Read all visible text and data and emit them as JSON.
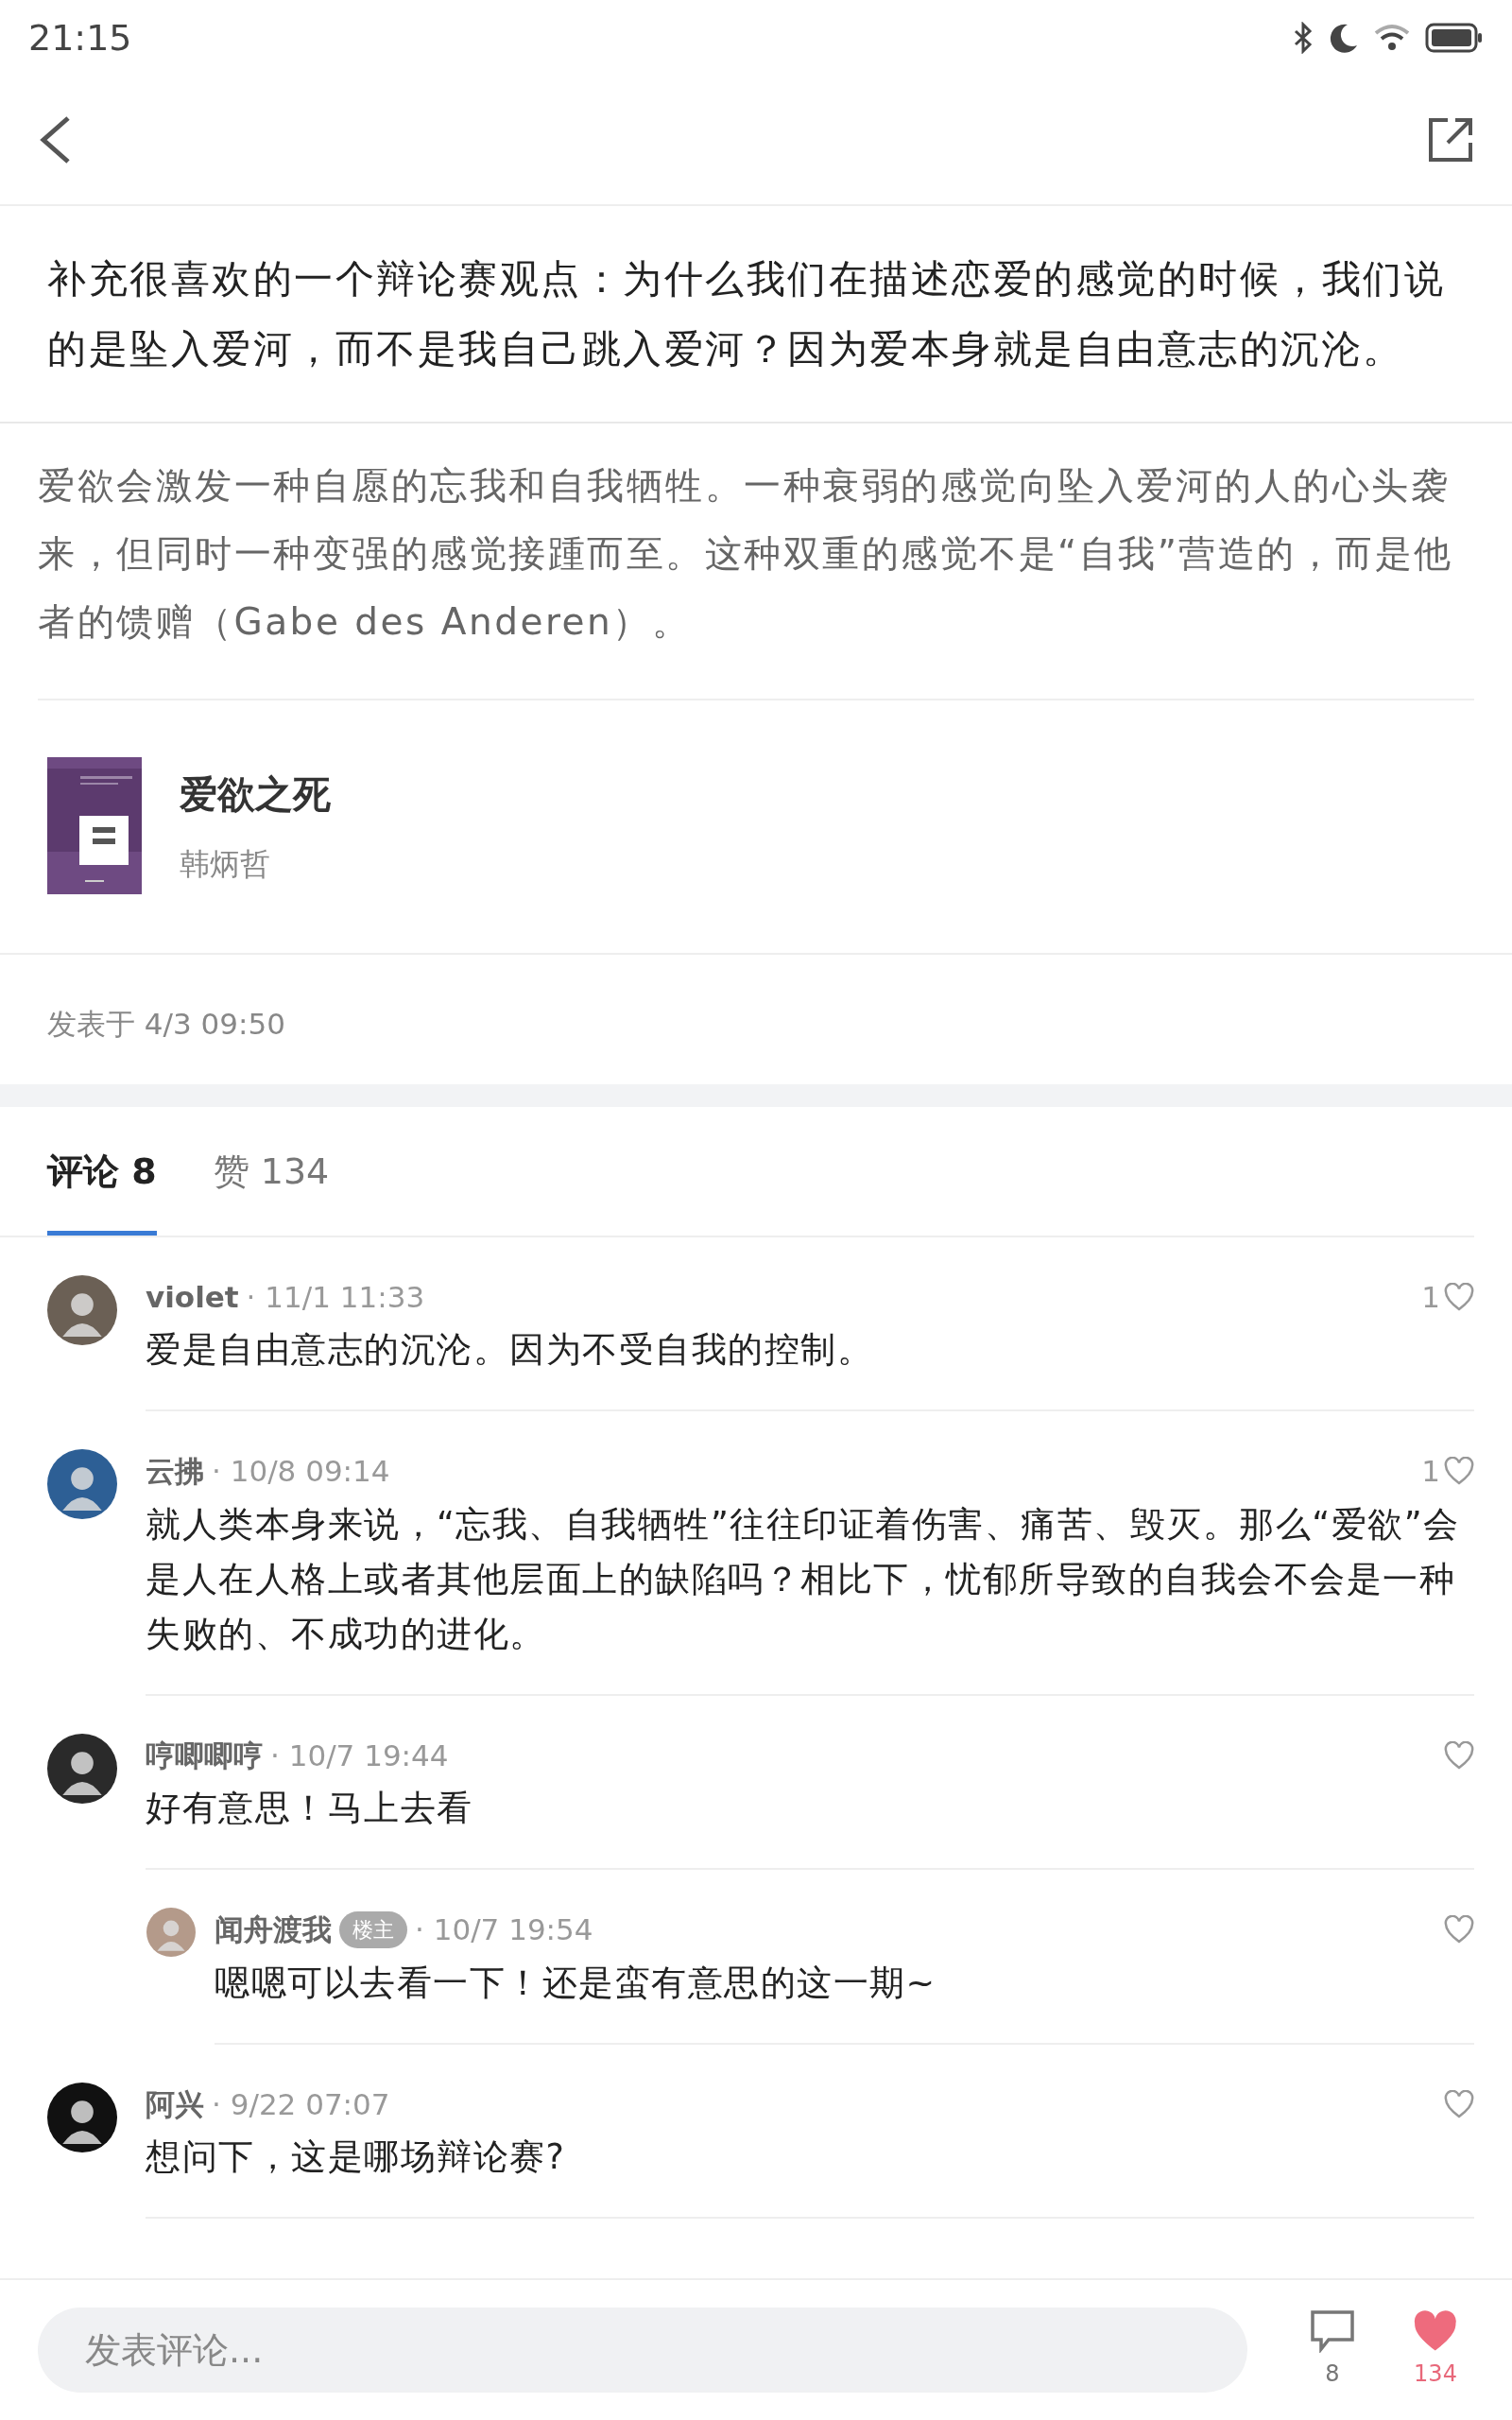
{
  "status_bar": {
    "time": "21:15"
  },
  "post": {
    "text": "补充很喜欢的一个辩论赛观点：为什么我们在描述恋爱的感觉的时候，我们说的是坠入爱河，而不是我自己跳入爱河？因为爱本身就是自由意志的沉沦。",
    "quote": "爱欲会激发一种自愿的忘我和自我牺牲。一种衰弱的感觉向坠入爱河的人的心头袭来，但同时一种变强的感觉接踵而至。这种双重的感觉不是“自我”营造的，而是他者的馈赠（Gabe des Anderen）。",
    "book": {
      "title": "爱欲之死",
      "author": "韩炳哲"
    },
    "posted": "发表于 4/3 09:50"
  },
  "tabs": [
    {
      "label": "评论 8",
      "selected": true
    },
    {
      "label": "赞 134",
      "selected": false
    }
  ],
  "comments": [
    {
      "author": "violet",
      "time": "· 11/1 11:33",
      "text": "爱是自由意志的沉沦。因为不受自我的控制。",
      "likes": "1"
    },
    {
      "author": "云拂",
      "time": "· 10/8 09:14",
      "text": "就人类本身来说，“忘我、自我牺牲”往往印证着伤害、痛苦、毁灭。那么“爱欲”会是人在人格上或者其他层面上的缺陷吗？相比下，忧郁所导致的自我会不会是一种失败的、不成功的进化。",
      "likes": "1"
    },
    {
      "author": "哼唧唧哼",
      "time": "· 10/7 19:44",
      "text": "好有意思！马上去看",
      "children": [
        {
          "author": "闻舟渡我",
          "badge": "楼主",
          "time": "· 10/7 19:54",
          "text": "嗯嗯可以去看一下！还是蛮有意思的这一期~"
        }
      ]
    },
    {
      "author": "阿兴",
      "time": "· 9/22 07:07",
      "text": "想问下，这是哪场辩论赛?"
    }
  ],
  "composer": {
    "placeholder": "发表评论..."
  },
  "actions": [
    {
      "kind": "comment",
      "count": "8",
      "on": false
    },
    {
      "kind": "like",
      "count": "134",
      "on": true
    }
  ]
}
